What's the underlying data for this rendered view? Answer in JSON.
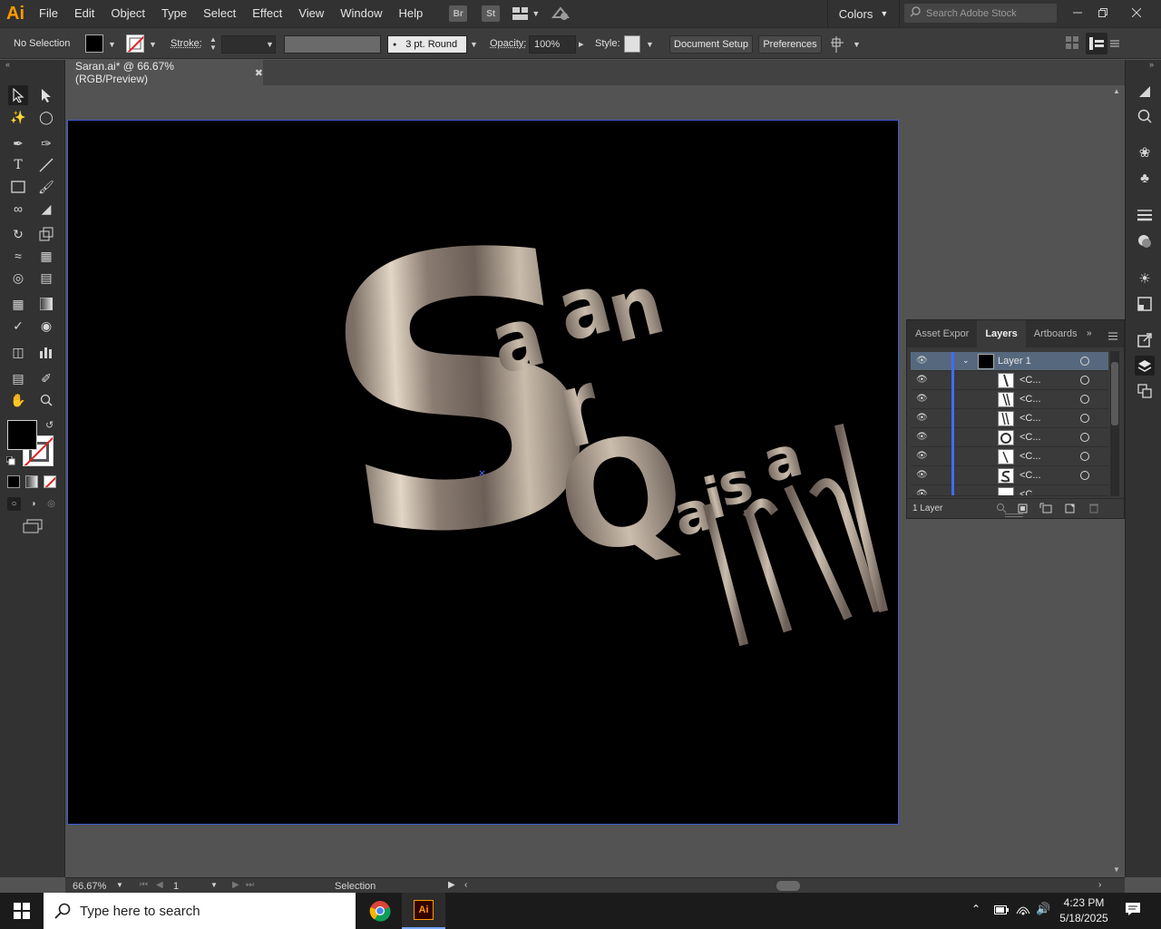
{
  "app": {
    "logo": "Ai"
  },
  "menu": [
    "File",
    "Edit",
    "Object",
    "Type",
    "Select",
    "Effect",
    "View",
    "Window",
    "Help"
  ],
  "menu_icons": {
    "bridge": "Br",
    "stock": "St"
  },
  "workspace": "Colors",
  "stock_search": {
    "placeholder": "Search Adobe Stock"
  },
  "control": {
    "selection": "No Selection",
    "stroke_label": "Stroke:",
    "brush": "3 pt. Round",
    "opacity_label": "Opacity:",
    "opacity_value": "100%",
    "style_label": "Style:",
    "document_setup": "Document Setup",
    "preferences": "Preferences"
  },
  "document": {
    "tab_title": "Saran.ai* @ 66.67% (RGB/Preview)"
  },
  "artwork": {
    "letter_s": "S",
    "arang": [
      "a",
      "r",
      "a",
      "n"
    ],
    "letter_q": "Q",
    "aisa": [
      "a",
      "i",
      "s",
      "a"
    ],
    "rni": [
      "r",
      "n",
      "i"
    ]
  },
  "layers_panel": {
    "tabs": [
      "Asset Expor",
      "Layers",
      "Artboards"
    ],
    "active_tab": "Layers",
    "layer_name": "Layer 1",
    "sublayers": [
      "<C...",
      "<C...",
      "<C...",
      "<C...",
      "<C...",
      "<C...",
      "<C..."
    ],
    "footer_count": "1 Layer"
  },
  "status": {
    "zoom": "66.67%",
    "artboard_number": "1",
    "tool": "Selection"
  },
  "taskbar": {
    "search_placeholder": "Type here to search",
    "time": "4:23 PM",
    "date": "5/18/2025"
  },
  "colors": {
    "ui_dark": "#323232",
    "canvas": "#535353",
    "artboard": "#000000",
    "artboard_border": "#3c5bd6",
    "metal_dark": "#6e625a",
    "metal_light": "#d8cbbb",
    "accent_orange": "#ff9a00",
    "layer_highlight": "#56687d"
  }
}
